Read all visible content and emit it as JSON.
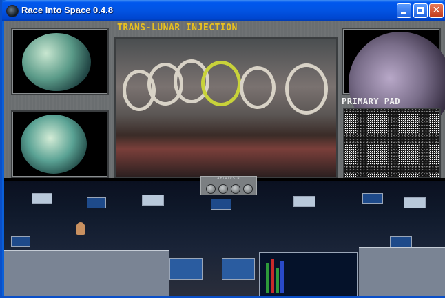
{
  "window": {
    "title": "Race Into Space 0.4.8",
    "buttons": {
      "minimize": "minimize-icon",
      "maximize": "maximize-icon",
      "close": "close-icon"
    }
  },
  "console": {
    "mission_title": "TRANS-LUNAR INJECTION",
    "pad_label": "PRIMARY PAD",
    "control_panel_label": "ABIRIVSIR",
    "knob_count": 4
  },
  "colors": {
    "title_text": "#e8c020",
    "pad_text": "#f2f2f2",
    "titlebar": "#0058ee",
    "active_ring": "#c8d23a"
  }
}
